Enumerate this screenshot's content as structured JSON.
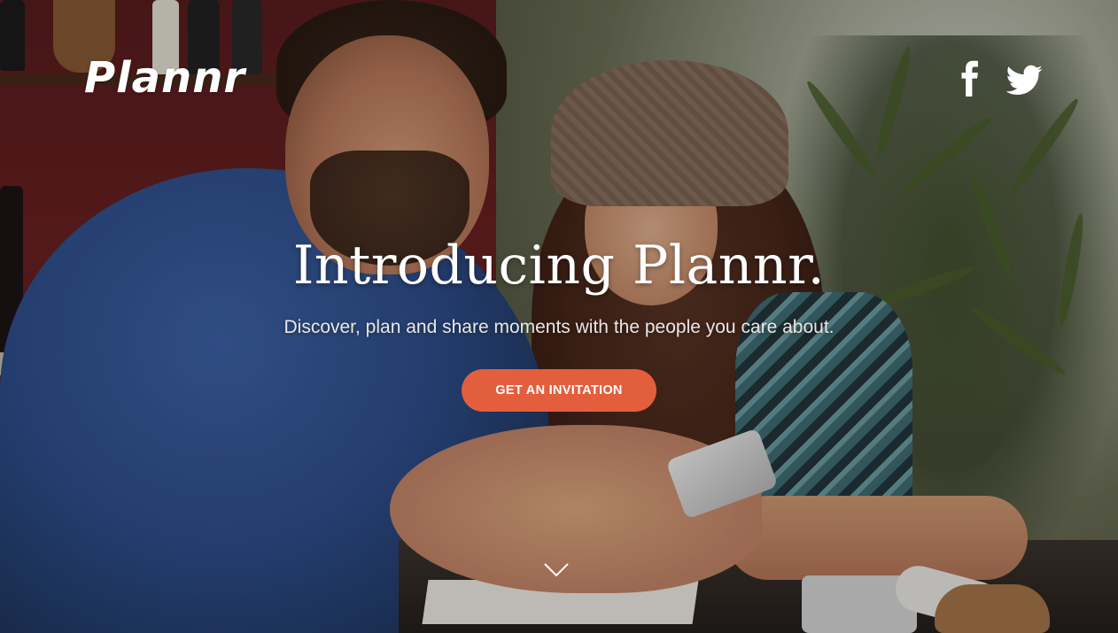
{
  "brand": {
    "logo_text": "Plannr"
  },
  "social": [
    {
      "icon": "facebook-icon",
      "label": "Facebook"
    },
    {
      "icon": "twitter-icon",
      "label": "Twitter"
    }
  ],
  "hero": {
    "headline": "Introducing Plannr.",
    "subheadline": "Discover, plan and share moments with the people you care about.",
    "cta_label": "GET AN INVITATION",
    "scroll_icon": "chevron-down-icon"
  },
  "colors": {
    "accent": "#e35e3c",
    "text": "#ffffff"
  }
}
